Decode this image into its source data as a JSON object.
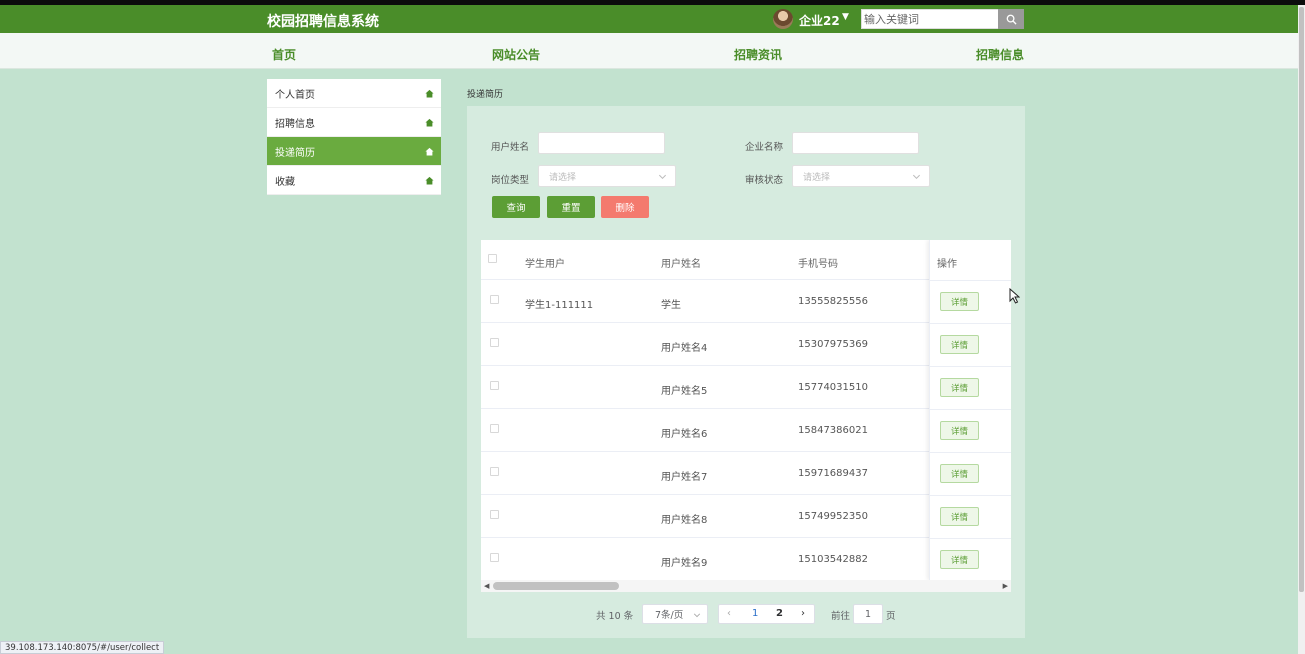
{
  "header": {
    "title": "校园招聘信息系统",
    "user_name": "企业22",
    "search_placeholder": "输入关键词"
  },
  "nav": [
    {
      "label": "首页"
    },
    {
      "label": "网站公告"
    },
    {
      "label": "招聘资讯"
    },
    {
      "label": "招聘信息"
    }
  ],
  "sidebar": {
    "items": [
      {
        "label": "个人首页",
        "active": false
      },
      {
        "label": "招聘信息",
        "active": false
      },
      {
        "label": "投递简历",
        "active": true
      },
      {
        "label": "收藏",
        "active": false
      }
    ]
  },
  "breadcrumb": "投递简历",
  "filters": {
    "user_name_label": "用户姓名",
    "company_name_label": "企业名称",
    "job_type_label": "岗位类型",
    "job_type_placeholder": "请选择",
    "review_status_label": "审核状态",
    "review_status_placeholder": "请选择"
  },
  "buttons": {
    "query": "查询",
    "reset": "重置",
    "delete": "删除"
  },
  "table": {
    "columns": [
      "学生用户",
      "用户姓名",
      "手机号码",
      "操作"
    ],
    "detail_label": "详情",
    "rows": [
      {
        "student": "学生1-111111",
        "name": "学生",
        "phone": "13555825556"
      },
      {
        "student": "",
        "name": "用户姓名4",
        "phone": "15307975369"
      },
      {
        "student": "",
        "name": "用户姓名5",
        "phone": "15774031510"
      },
      {
        "student": "",
        "name": "用户姓名6",
        "phone": "15847386021"
      },
      {
        "student": "",
        "name": "用户姓名7",
        "phone": "15971689437"
      },
      {
        "student": "",
        "name": "用户姓名8",
        "phone": "15749952350"
      },
      {
        "student": "",
        "name": "用户姓名9",
        "phone": "15103542882"
      }
    ]
  },
  "pagination": {
    "total": "共 10 条",
    "page_size": "7条/页",
    "pages": [
      "1",
      "2"
    ],
    "current_page": "1",
    "goto_label": "前往",
    "goto_value": "1",
    "goto_unit": "页"
  },
  "status_url": "39.108.173.140:8075/#/user/collect",
  "colors": {
    "brand": "#4a8d29",
    "active": "#6aab3f",
    "danger": "#f47a6e",
    "background": "#c2e2cf"
  }
}
